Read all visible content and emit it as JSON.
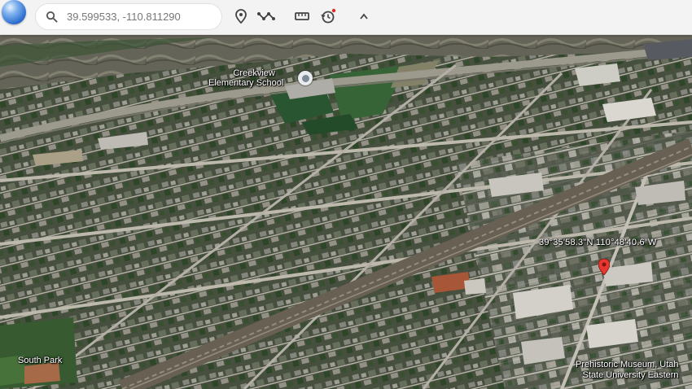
{
  "search": {
    "value": "39.599533, -110.811290"
  },
  "toolbar": {
    "place_icon": "map-pin",
    "path_icon": "path-line",
    "measure_icon": "ruler",
    "history_icon": "history-clock",
    "collapse_icon": "chevron-up"
  },
  "map": {
    "places": [
      {
        "line1": "Creekview",
        "line2": "Elementary School"
      },
      {
        "line1": "South Park",
        "line2": ""
      },
      {
        "line1": "Prehistoric Museum, Utah",
        "line2": "State University Eastern"
      }
    ],
    "coordinate_readout": "39°35'58.3\"N 110°48'40.6\"W",
    "marker_color": "#e8372e"
  }
}
